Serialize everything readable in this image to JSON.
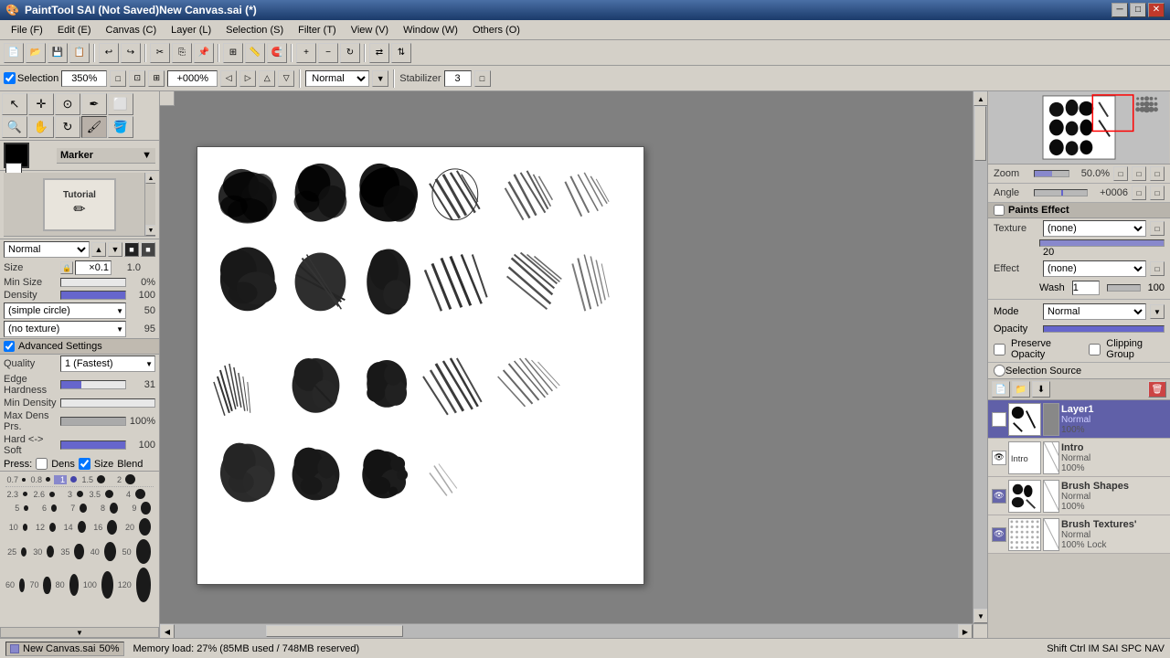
{
  "titlebar": {
    "title": "PaintTool SAI  (Not Saved)New Canvas.sai (*)",
    "icon": "🎨",
    "min_btn": "─",
    "max_btn": "□",
    "close_btn": "✕"
  },
  "menubar": {
    "items": [
      {
        "id": "file",
        "label": "File (F)"
      },
      {
        "id": "edit",
        "label": "Edit (E)"
      },
      {
        "id": "canvas",
        "label": "Canvas (C)"
      },
      {
        "id": "layer",
        "label": "Layer (L)"
      },
      {
        "id": "selection",
        "label": "Selection (S)"
      },
      {
        "id": "filter",
        "label": "Filter (T)"
      },
      {
        "id": "view",
        "label": "View (V)"
      },
      {
        "id": "window",
        "label": "Window (W)"
      },
      {
        "id": "others",
        "label": "Others (O)"
      }
    ]
  },
  "toolbar1": {
    "buttons": [
      "new",
      "open",
      "save",
      "saveas",
      "sep",
      "undo",
      "redo",
      "sep",
      "cut",
      "copy",
      "paste",
      "sep",
      "grid",
      "ruler",
      "sep",
      "zoom_in",
      "zoom_out"
    ]
  },
  "toolbar2": {
    "selection_label": "Selection",
    "zoom_value": "350%",
    "zoom_input": "+000%",
    "blend_mode": "Normal",
    "stabilizer_label": "Stabilizer",
    "stabilizer_value": "3"
  },
  "left_panel": {
    "marker_label": "Marker",
    "brush_preset": {
      "name": "Tutorial",
      "icon": "✏"
    },
    "blend_mode": "Normal",
    "size": {
      "label": "Size",
      "value": "0.1",
      "max": "1.0"
    },
    "min_size": {
      "label": "Min Size",
      "value": "0%"
    },
    "density": {
      "label": "Density",
      "value": "100"
    },
    "brush_shape": {
      "label": "(simple circle)",
      "value": "50"
    },
    "brush_texture": {
      "label": "(no texture)",
      "value": "95"
    },
    "advanced_settings_label": "Advanced Settings",
    "quality": {
      "label": "Quality",
      "value": "1 (Fastest)"
    },
    "edge_hardness": {
      "label": "Edge Hardness",
      "value": "31"
    },
    "min_density": {
      "label": "Min Density",
      "value": ""
    },
    "max_dens_prs": {
      "label": "Max Dens Prs.",
      "value": "100%"
    },
    "hard_soft": {
      "label": "Hard <-> Soft",
      "value": "100"
    },
    "press_labels": [
      "Press:",
      "Dens",
      "Size",
      "Blend"
    ],
    "size_presets": [
      {
        "label": "0.7",
        "size": 3
      },
      {
        "label": "0.8",
        "size": 4
      },
      {
        "label": "1",
        "size": 6,
        "selected": true
      },
      {
        "label": "1.5",
        "size": 8
      },
      {
        "label": "2",
        "size": 10
      },
      {
        "label": "2.3",
        "size": 12
      },
      {
        "label": "2.6",
        "size": 14
      },
      {
        "label": "3",
        "size": 16
      },
      {
        "label": "3.5",
        "size": 18
      },
      {
        "label": "4",
        "size": 20
      },
      {
        "label": "5",
        "size": 6
      },
      {
        "label": "6",
        "size": 8
      },
      {
        "label": "7",
        "size": 10
      },
      {
        "label": "8",
        "size": 12
      },
      {
        "label": "9",
        "size": 14
      },
      {
        "label": "10",
        "size": 16
      },
      {
        "label": "12",
        "size": 20
      },
      {
        "label": "14",
        "size": 24
      },
      {
        "label": "16",
        "size": 28
      },
      {
        "label": "20",
        "size": 32
      },
      {
        "label": "25",
        "size": 14
      },
      {
        "label": "30",
        "size": 18
      },
      {
        "label": "35",
        "size": 22
      },
      {
        "label": "40",
        "size": 28
      },
      {
        "label": "50",
        "size": 34
      },
      {
        "label": "60",
        "size": 20
      },
      {
        "label": "70",
        "size": 24
      },
      {
        "label": "80",
        "size": 30
      },
      {
        "label": "100",
        "size": 38
      },
      {
        "label": "120",
        "size": 46
      }
    ]
  },
  "right_panel": {
    "zoom_label": "Zoom",
    "zoom_value": "50.0%",
    "angle_label": "Angle",
    "angle_value": "+0006",
    "paints_effect_label": "Paints Effect",
    "texture_label": "Texture",
    "texture_value": "(none)",
    "texture_percent": "100%",
    "texture_num": "20",
    "effect_label": "Effect",
    "effect_value": "(none)",
    "effect_wash": "Wash",
    "effect_wash_val": "1",
    "effect_wash_num": "100",
    "mode_label": "Mode",
    "mode_value": "Normal",
    "opacity_label": "Opacity",
    "preserve_label": "Preserve Opacity",
    "clipping_label": "Clipping Group",
    "selection_label": "Selection Source",
    "layers": [
      {
        "id": "layer1",
        "name": "Layer1",
        "mode": "Normal",
        "opacity": "100%",
        "visible": true,
        "active": true,
        "has_mask": true
      },
      {
        "id": "intro",
        "name": "Intro",
        "mode": "Normal",
        "opacity": "100%",
        "visible": true,
        "active": false
      },
      {
        "id": "brush_shapes",
        "name": "Brush Shapes",
        "mode": "Normal",
        "opacity": "100%",
        "visible": true,
        "active": false
      },
      {
        "id": "brush_textures",
        "name": "Brush Textures'",
        "mode": "Normal",
        "opacity": "100% Lock",
        "visible": true,
        "active": false
      }
    ]
  },
  "statusbar": {
    "canvas_name": "New Canvas.sai",
    "zoom": "50%",
    "memory_label": "Memory load: 27%  (85MB used / 748MB reserved)",
    "shortcut_hint": "Shift Ctrl IM   SAI   SPC   NAV"
  }
}
